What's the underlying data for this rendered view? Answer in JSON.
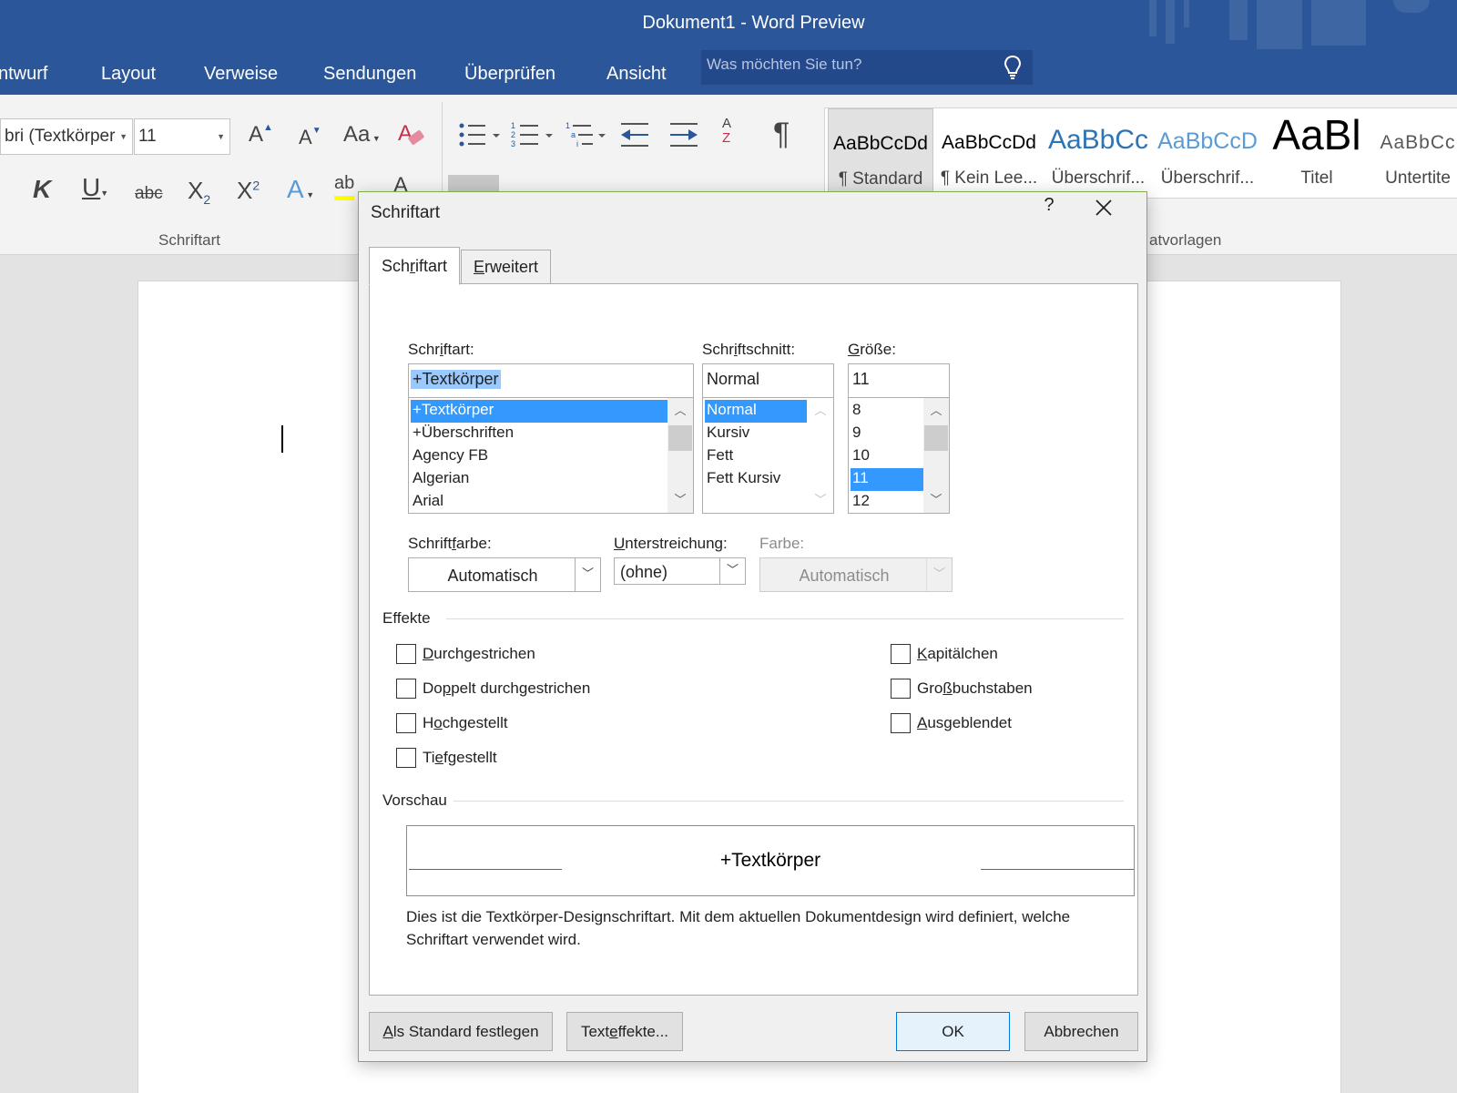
{
  "app": {
    "title": "Dokument1 - Word Preview",
    "accent_color": "#2b579a"
  },
  "ribbon_tabs": [
    "ntwurf",
    "Layout",
    "Verweise",
    "Sendungen",
    "Überprüfen",
    "Ansicht"
  ],
  "search": {
    "placeholder": "Was möchten Sie tun?",
    "icon": "lightbulb-icon"
  },
  "ribbon": {
    "font_name": "bri (Textkörper",
    "font_size": "11",
    "grow_font": "A",
    "shrink_font": "A",
    "change_case": "Aa",
    "bold": "K",
    "underline": "U",
    "strikethrough": "abc",
    "subscript": "X",
    "subscript_mark": "2",
    "superscript": "X",
    "superscript_mark": "2",
    "text_effects": "A",
    "highlight": "ab",
    "font_color": "A",
    "sort": "A",
    "sort_b": "Z",
    "pilcrow": "¶",
    "group_font_label": "Schriftart",
    "group_styles_label": "atvorlagen"
  },
  "styles_gallery": [
    {
      "sample": "AaBbCcDd",
      "name": "¶ Standard"
    },
    {
      "sample": "AaBbCcDd",
      "name": "¶ Kein Lee..."
    },
    {
      "sample": "AaBbCc",
      "name": "Überschrif..."
    },
    {
      "sample": "AaBbCcD",
      "name": "Überschrif..."
    },
    {
      "sample": "AaBl",
      "name": "Titel"
    },
    {
      "sample": "AaBbCc",
      "name": "Untertite"
    }
  ],
  "dialog": {
    "title": "Schriftart",
    "help": "?",
    "tabs": [
      {
        "pre": "Sch",
        "key": "r",
        "post": "iftart"
      },
      {
        "pre": "",
        "key": "E",
        "post": "rweitert"
      }
    ],
    "font": {
      "label": {
        "pre": "Schr",
        "key": "i",
        "post": "ftart:"
      },
      "value": "+Textkörper",
      "items": [
        "+Textkörper",
        "+Überschriften",
        "Agency FB",
        "Algerian",
        "Arial"
      ],
      "selected_index": 0
    },
    "style": {
      "label": {
        "pre": "Schr",
        "key": "i",
        "post": "ftschnitt:"
      },
      "value": "Normal",
      "items": [
        "Normal",
        "Kursiv",
        "Fett",
        "Fett Kursiv"
      ],
      "selected_index": 0
    },
    "size": {
      "label": {
        "pre": "",
        "key": "G",
        "post": "röße:"
      },
      "value": "11",
      "items": [
        "8",
        "9",
        "10",
        "11",
        "12"
      ],
      "selected_index": 3
    },
    "font_color": {
      "label": {
        "pre": "Schrift",
        "key": "f",
        "post": "arbe:"
      },
      "value": "Automatisch"
    },
    "underline": {
      "label": {
        "pre": "",
        "key": "U",
        "post": "nterstreichung:"
      },
      "value": "(ohne)"
    },
    "underline_color": {
      "label": "Farbe:",
      "value": "Automatisch"
    },
    "effects_title": "Effekte",
    "effects_left": [
      {
        "pre": "",
        "key": "D",
        "post": "urchgestrichen",
        "checked": false
      },
      {
        "pre": "Do",
        "key": "p",
        "post": "pelt durchgestrichen",
        "checked": false
      },
      {
        "pre": "H",
        "key": "o",
        "post": "chgestellt",
        "checked": false
      },
      {
        "pre": "Ti",
        "key": "e",
        "post": "fgestellt",
        "checked": false
      }
    ],
    "effects_right": [
      {
        "pre": "",
        "key": "K",
        "post": "apitälchen",
        "checked": false
      },
      {
        "pre": "Gro",
        "key": "ß",
        "post": "buchstaben",
        "checked": false
      },
      {
        "pre": "",
        "key": "A",
        "post": "usgeblendet",
        "checked": false
      }
    ],
    "preview_title": "Vorschau",
    "preview_text": "+Textkörper",
    "preview_description": "Dies ist die Textkörper-Designschriftart. Mit dem aktuellen Dokumentdesign wird definiert, welche Schriftart verwendet wird.",
    "buttons": {
      "set_default": {
        "pre": "",
        "key": "A",
        "post": "ls Standard festlegen"
      },
      "text_effects": {
        "pre": "Text",
        "key": "e",
        "post": "ffekte..."
      },
      "ok": "OK",
      "cancel": "Abbrechen"
    }
  }
}
